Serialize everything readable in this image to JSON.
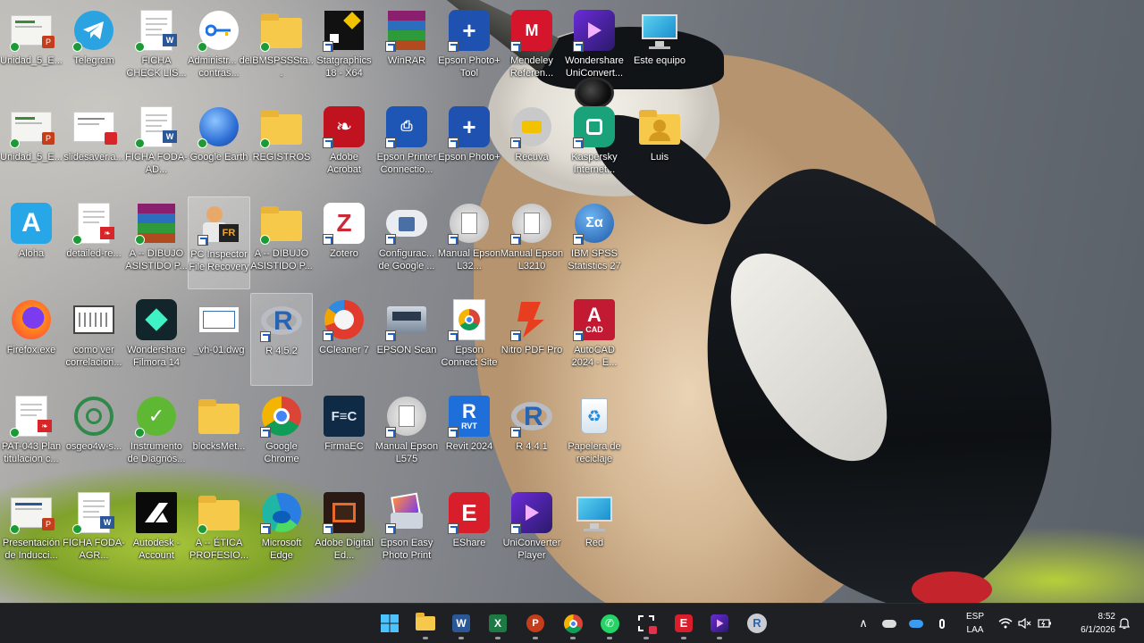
{
  "desktop": {
    "icons": [
      {
        "label": "Unidad_5_E..."
      },
      {
        "label": "Telegram"
      },
      {
        "label": "FICHA CHECK LIS..."
      },
      {
        "label": "Administr... de contras..."
      },
      {
        "label": "IBMSPSSSta..."
      },
      {
        "label": "Statgraphics 18 - X64"
      },
      {
        "label": "WinRAR"
      },
      {
        "label": "Epson Photo+ Tool"
      },
      {
        "label": "Mendeley Referen..."
      },
      {
        "label": "Wondershare UniConvert..."
      },
      {
        "label": "Este equipo"
      },
      {
        "label": "Unidad_5_E..."
      },
      {
        "label": "slidesaver.a..."
      },
      {
        "label": "FICHA FODA-AD..."
      },
      {
        "label": "Google Earth"
      },
      {
        "label": "REGISTROS"
      },
      {
        "label": "Adobe Acrobat"
      },
      {
        "label": "Epson Printer Connectio..."
      },
      {
        "label": "Epson Photo+"
      },
      {
        "label": "Recuva"
      },
      {
        "label": "Kaspersky Internet..."
      },
      {
        "label": "Luis"
      },
      {
        "label": "Aloha"
      },
      {
        "label": "detailed-re..."
      },
      {
        "label": "A -- DIBUJO ASISTIDO P..."
      },
      {
        "label": "PC Inspector File Recovery"
      },
      {
        "label": "A -- DIBUJO ASISTIDO P..."
      },
      {
        "label": "Zotero"
      },
      {
        "label": "Configurac... de Google ..."
      },
      {
        "label": "Manual Epson L32..."
      },
      {
        "label": "Manual Epson L3210"
      },
      {
        "label": "IBM SPSS Statistics 27"
      },
      {
        "label": "Firefox.exe"
      },
      {
        "label": "como ver correlacion..."
      },
      {
        "label": "Wondershare Filmora 14"
      },
      {
        "label": "_vh-01.dwg"
      },
      {
        "label": "R 4.5.2"
      },
      {
        "label": "CCleaner 7"
      },
      {
        "label": "EPSON Scan"
      },
      {
        "label": "Epson Connect Site"
      },
      {
        "label": "Nitro PDF Pro"
      },
      {
        "label": "AutoCAD 2024 - E..."
      },
      {
        "label": "PAT-043 Plan titulacion c..."
      },
      {
        "label": "osgeo4w-s..."
      },
      {
        "label": "Instrumento de Diagnós..."
      },
      {
        "label": "blocksMet..."
      },
      {
        "label": "Google Chrome"
      },
      {
        "label": "FirmaEC"
      },
      {
        "label": "Manual Epson L575"
      },
      {
        "label": "Revit 2024"
      },
      {
        "label": "R 4.4.1"
      },
      {
        "label": "Papelera de reciclaje"
      },
      {
        "label": "Presentación de Inducci..."
      },
      {
        "label": "FICHA FODA-AGR..."
      },
      {
        "label": "Autodesk - Account"
      },
      {
        "label": "A -- ÉTICA PROFESIO..."
      },
      {
        "label": "Microsoft Edge"
      },
      {
        "label": "Adobe Digital Ed..."
      },
      {
        "label": "Epson Easy Photo Print"
      },
      {
        "label": "EShare"
      },
      {
        "label": "UniConverter Player"
      },
      {
        "label": "Red"
      }
    ]
  },
  "taskbar": {
    "language": "ESP",
    "layout": "LAA",
    "time": "8:52",
    "date": "6/1/2026"
  }
}
